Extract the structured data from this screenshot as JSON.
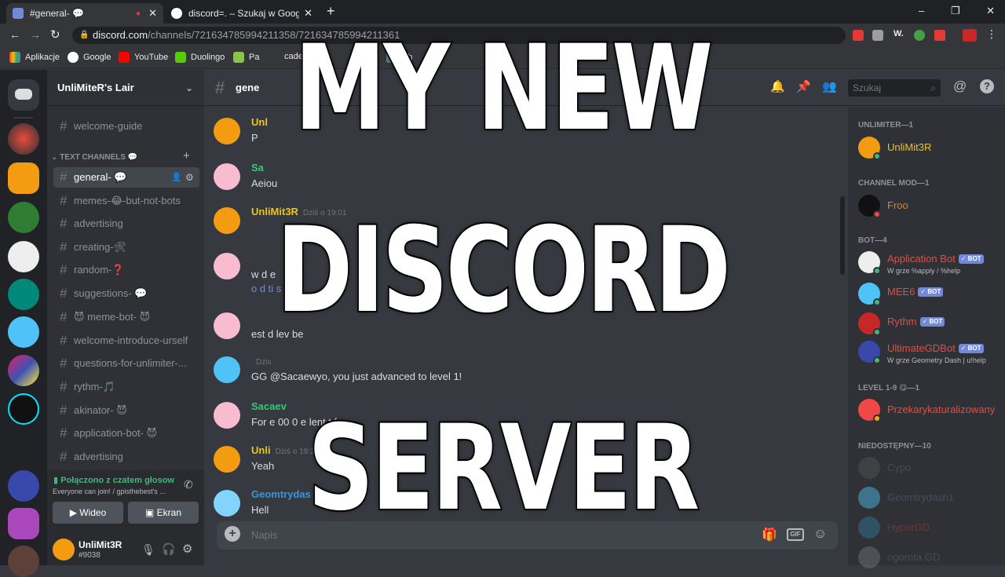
{
  "browser": {
    "tabs": [
      {
        "title": "#general- 💬",
        "active": true
      },
      {
        "title": "discord=. – Szukaj w Google",
        "active": false
      }
    ],
    "url_host": "discord.com",
    "url_path": "/channels/721634785994211358/721634785994211361",
    "bookmarks": [
      "Aplikacje",
      "Google",
      "YouTube",
      "Duolingo",
      "Pa",
      "cade",
      "Ph"
    ]
  },
  "server": {
    "name": "UnliMiteR's Lair",
    "top_channel": "welcome-guide",
    "category": "TEXT CHANNELS 💬",
    "channels": [
      "general- 💬",
      "memes-😂-but-not-bots",
      "advertising",
      "creating-🛠",
      "random-❓",
      "suggestions- 💬",
      "😈 meme-bot- 😈",
      "welcome-introduce-urself",
      "questions-for-unlimiter-...",
      "rythm-🎵",
      "akinator- 😈",
      "application-bot- 😈",
      "advertising"
    ]
  },
  "voice": {
    "status": "Połączono z czatem głosow",
    "subtitle": "Everyone can join! / gpisthebest's ...",
    "video_label": "Wideo",
    "screen_label": "Ekran"
  },
  "user": {
    "name": "UnliMit3R",
    "tag": "#9038"
  },
  "header": {
    "channel": "gene",
    "search_placeholder": "Szukaj"
  },
  "messages": [
    {
      "author": "Unl",
      "color": "#f1c40f",
      "time": "",
      "text": "P"
    },
    {
      "author": "Sa",
      "color": "#2ecc71",
      "time": "",
      "text": "Aeiou"
    },
    {
      "author": "UnliMit3R",
      "color": "#f1c40f",
      "time": "Dziś o 19:01",
      "text": ""
    },
    {
      "author": "",
      "color": "#2ecc71",
      "time": "",
      "text": "w d          e"
    },
    {
      "author": "",
      "color": "#2ecc71",
      "time": "",
      "text": "o   d     ti            s"
    },
    {
      "author": "",
      "color": "#2ecc71",
      "time": "",
      "text": "est         d          lev            be"
    },
    {
      "author": "",
      "color": "#7289da",
      "time": "Dzis",
      "text": "GG @Sacaewyo, you just advanced to level 1!"
    },
    {
      "author": "Sacaev",
      "color": "#2ecc71",
      "time": "",
      "text": "For e            00            0                  e       lent t       f"
    },
    {
      "author": "Unli",
      "color": "#f1c40f",
      "time": "Dziś o 19:29",
      "text": "Yeah"
    },
    {
      "author": "Geomtrydas",
      "color": "#3498db",
      "time": "",
      "text": "Hell"
    }
  ],
  "composer_placeholder": "Napis",
  "members": {
    "groups": [
      {
        "label": "UNLIMITER—1",
        "members": [
          {
            "name": "UnliMit3R",
            "color": "#f1c40f",
            "bot": false,
            "status": ""
          }
        ]
      },
      {
        "label": "CHANNEL MOD—1",
        "members": [
          {
            "name": "Froo",
            "color": "#e67e22",
            "bot": false,
            "status": ""
          }
        ]
      },
      {
        "label": "BOT—4",
        "members": [
          {
            "name": "Application Bot",
            "color": "#e74c3c",
            "bot": true,
            "status": "W grze %apply / %help"
          },
          {
            "name": "MEE6",
            "color": "#e74c3c",
            "bot": true,
            "status": ""
          },
          {
            "name": "Rythm",
            "color": "#e74c3c",
            "bot": true,
            "status": ""
          },
          {
            "name": "UltimateGDBot",
            "color": "#e74c3c",
            "bot": true,
            "status": "W grze Geometry Dash | u!help"
          }
        ]
      },
      {
        "label": "LEVEL 1-9 😋—1",
        "members": [
          {
            "name": "Przekarykaturalizowany",
            "color": "#e74c3c",
            "bot": false,
            "status": ""
          }
        ]
      },
      {
        "label": "NIEDOSTĘPNY—10",
        "members": [
          {
            "name": "Cypo",
            "color": "#5b6e8a",
            "bot": false,
            "status": ""
          },
          {
            "name": "Geomtrydash1",
            "color": "#5b6e8a",
            "bot": false,
            "status": ""
          },
          {
            "name": "HyperGD",
            "color": "#7a5050",
            "bot": false,
            "status": ""
          },
          {
            "name": "ogorota GD",
            "color": "#5b6e8a",
            "bot": false,
            "status": ""
          }
        ]
      }
    ],
    "bot_badge": "✓ BOT"
  },
  "overlay": {
    "line1": "MY NEW",
    "line2": "DISCORD",
    "line3": "SERVER"
  }
}
